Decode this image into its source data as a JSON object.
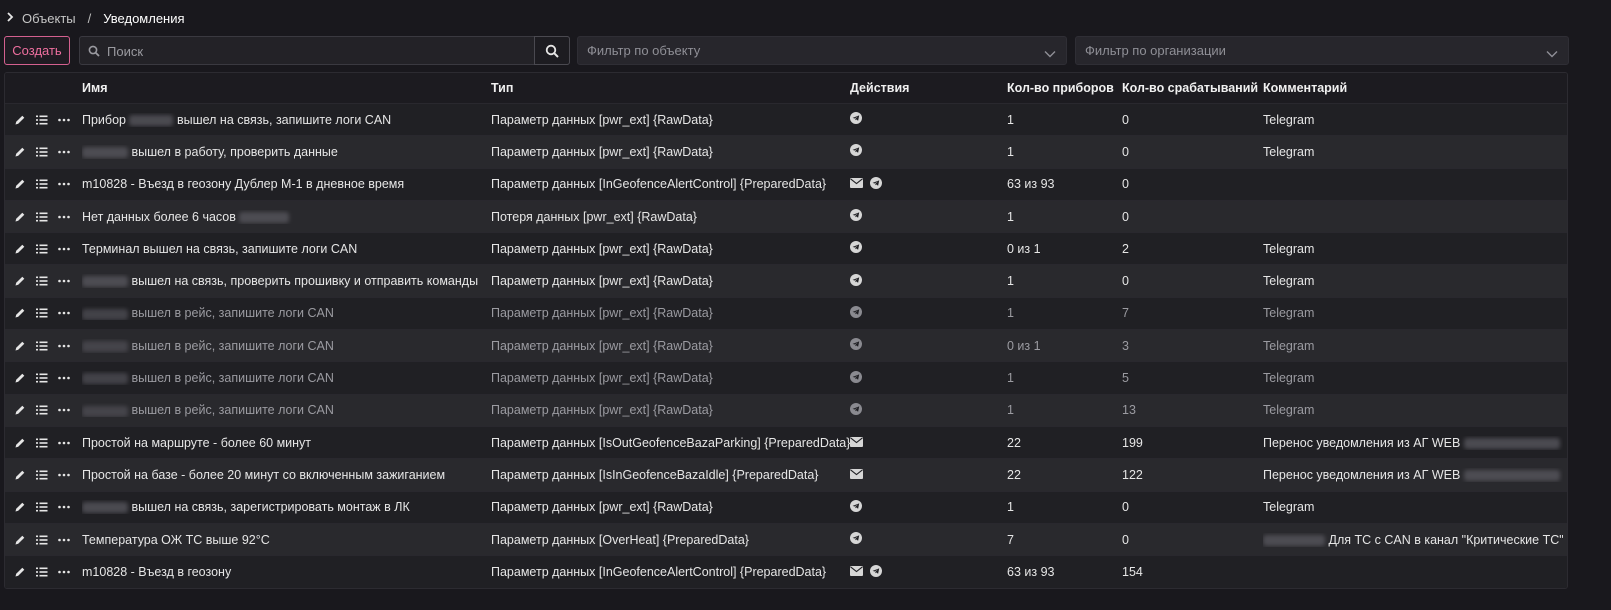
{
  "breadcrumb": {
    "chevron_icon": "chevron-right-icon",
    "parent": "Объекты",
    "separator": "/",
    "current": "Уведомления"
  },
  "toolbar": {
    "create_label": "Создать",
    "search_placeholder": "Поиск",
    "search_icon": "search-icon",
    "object_filter_placeholder": "Фильтр по объекту",
    "org_filter_placeholder": "Фильтр по организации"
  },
  "colors": {
    "background": "#19181d",
    "accent": "#ee6f9f",
    "row_odd": "#202024",
    "row_even": "#29292d"
  },
  "table": {
    "columns": {
      "name": "Имя",
      "type": "Тип",
      "actions": "Действия",
      "devices": "Кол-во приборов",
      "triggers": "Кол-во срабатываний",
      "comment": "Комментарий"
    },
    "row_icons": [
      "pencil-icon",
      "list-icon",
      "ellipsis-icon"
    ],
    "rows": [
      {
        "name_pre": "Прибор",
        "name_post": "вышел на связь, запишите логи CAN",
        "type": "Параметр данных [pwr_ext] {RawData}",
        "actions": [
          "telegram"
        ],
        "devices": "1",
        "triggers": "0",
        "comment": "Telegram"
      },
      {
        "name_pre": "",
        "name_post": "вышел в работу, проверить данные",
        "type": "Параметр данных [pwr_ext] {RawData}",
        "actions": [
          "telegram"
        ],
        "devices": "1",
        "triggers": "0",
        "comment": "Telegram"
      },
      {
        "name_pre": "m10828 - Въезд в геозону Дублер М-1 в дневное время",
        "name_post": "",
        "type": "Параметр данных [InGeofenceAlertControl] {PreparedData}",
        "actions": [
          "email",
          "telegram"
        ],
        "devices": "63 из 93",
        "triggers": "0",
        "comment": ""
      },
      {
        "name_pre": "Нет данных более 6 часов",
        "name_post": "",
        "type": "Потеря данных [pwr_ext] {RawData}",
        "actions": [
          "telegram"
        ],
        "devices": "1",
        "triggers": "0",
        "comment": ""
      },
      {
        "name_pre": "Терминал вышел на связь, запишите логи CAN",
        "name_post": "",
        "type": "Параметр данных [pwr_ext] {RawData}",
        "actions": [
          "telegram"
        ],
        "devices": "0 из 1",
        "triggers": "2",
        "comment": "Telegram"
      },
      {
        "name_pre": "",
        "name_post": "вышел на связь, проверить прошивку и отправить команды",
        "type": "Параметр данных [pwr_ext] {RawData}",
        "actions": [
          "telegram"
        ],
        "devices": "1",
        "triggers": "0",
        "comment": "Telegram"
      },
      {
        "name_pre": "",
        "name_post": "вышел в рейс, запишите логи CAN",
        "type": "Параметр данных [pwr_ext] {RawData}",
        "actions": [
          "telegram"
        ],
        "devices": "1",
        "triggers": "7",
        "comment": "Telegram"
      },
      {
        "name_pre": "",
        "name_post": "вышел в рейс, запишите логи CAN",
        "type": "Параметр данных [pwr_ext] {RawData}",
        "actions": [
          "telegram"
        ],
        "devices": "0 из 1",
        "triggers": "3",
        "comment": "Telegram"
      },
      {
        "name_pre": "",
        "name_post": "вышел в рейс, запишите логи CAN",
        "type": "Параметр данных [pwr_ext] {RawData}",
        "actions": [
          "telegram"
        ],
        "devices": "1",
        "triggers": "5",
        "comment": "Telegram"
      },
      {
        "name_pre": "",
        "name_post": "вышел в рейс, запишите логи CAN",
        "type": "Параметр данных [pwr_ext] {RawData}",
        "actions": [
          "telegram"
        ],
        "devices": "1",
        "triggers": "13",
        "comment": "Telegram"
      },
      {
        "name_pre": "Простой на маршруте - более 60 минут",
        "name_post": "",
        "type": "Параметр данных [IsOutGeofenceBazaParking] {PreparedData}",
        "actions": [
          "email"
        ],
        "devices": "22",
        "triggers": "199",
        "comment": "Перенос уведомления из АГ WEB"
      },
      {
        "name_pre": "Простой на базе - более 20 минут со включенным зажиганием",
        "name_post": "",
        "type": "Параметр данных [IsInGeofenceBazaIdle] {PreparedData}",
        "actions": [
          "email"
        ],
        "devices": "22",
        "triggers": "122",
        "comment": "Перенос уведомления из АГ WEB"
      },
      {
        "name_pre": "",
        "name_post": "вышел на связь, зарегистрировать монтаж в ЛК",
        "type": "Параметр данных [pwr_ext] {RawData}",
        "actions": [
          "telegram"
        ],
        "devices": "1",
        "triggers": "0",
        "comment": "Telegram"
      },
      {
        "name_pre": "Температура ОЖ ТС выше 92°C",
        "name_post": "",
        "type": "Параметр данных [OverHeat] {PreparedData}",
        "actions": [
          "telegram"
        ],
        "devices": "7",
        "triggers": "0",
        "comment": "Для ТС с CAN в канал \"Критические ТС\""
      },
      {
        "name_pre": "m10828 - Въезд в геозону",
        "name_post": "",
        "type": "Параметр данных [InGeofenceAlertControl] {PreparedData}",
        "actions": [
          "email",
          "telegram"
        ],
        "devices": "63 из 93",
        "triggers": "154",
        "comment": ""
      }
    ]
  }
}
